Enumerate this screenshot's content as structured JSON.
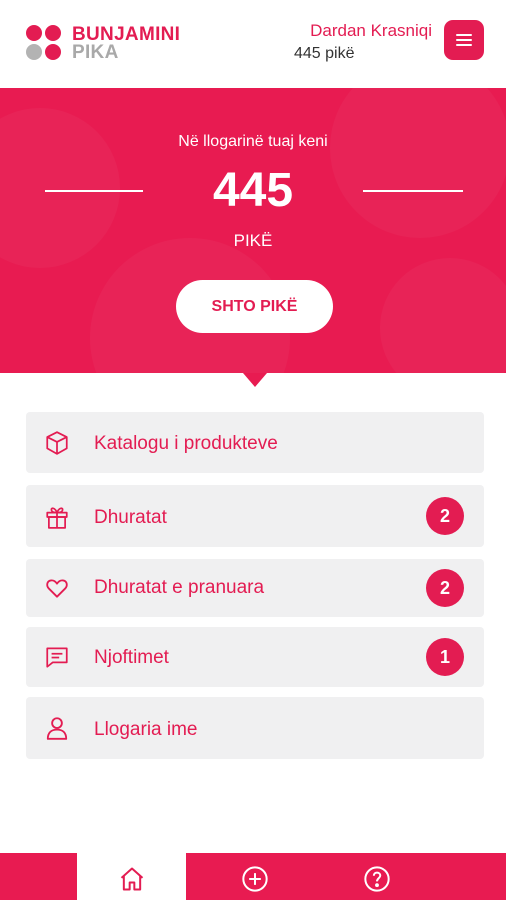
{
  "brand": {
    "line1": "BUNJAMINI",
    "line2": "PIKA"
  },
  "user": {
    "name": "Dardan Krasniqi",
    "points_label": "445 pikë"
  },
  "hero": {
    "caption": "Në llogarinë tuaj keni",
    "points": "445",
    "unit": "PIKË",
    "add_button": "SHTO PIKË"
  },
  "menu": [
    {
      "label": "Katalogu i produkteve",
      "icon": "box-icon",
      "badge": null
    },
    {
      "label": "Dhuratat",
      "icon": "gift-icon",
      "badge": "2"
    },
    {
      "label": "Dhuratat e pranuara",
      "icon": "heart-icon",
      "badge": "2"
    },
    {
      "label": "Njoftimet",
      "icon": "chat-icon",
      "badge": "1"
    },
    {
      "label": "Llogaria ime",
      "icon": "user-icon",
      "badge": null
    }
  ],
  "bottom_nav": [
    {
      "icon": "home-icon",
      "active": true
    },
    {
      "icon": "plus-circle-icon",
      "active": false
    },
    {
      "icon": "help-icon",
      "active": false
    }
  ],
  "colors": {
    "accent": "#e31c52",
    "hero_bg": "#e81b51",
    "item_bg": "#f0f0f1",
    "logo_gray": "#a9a9a9"
  }
}
